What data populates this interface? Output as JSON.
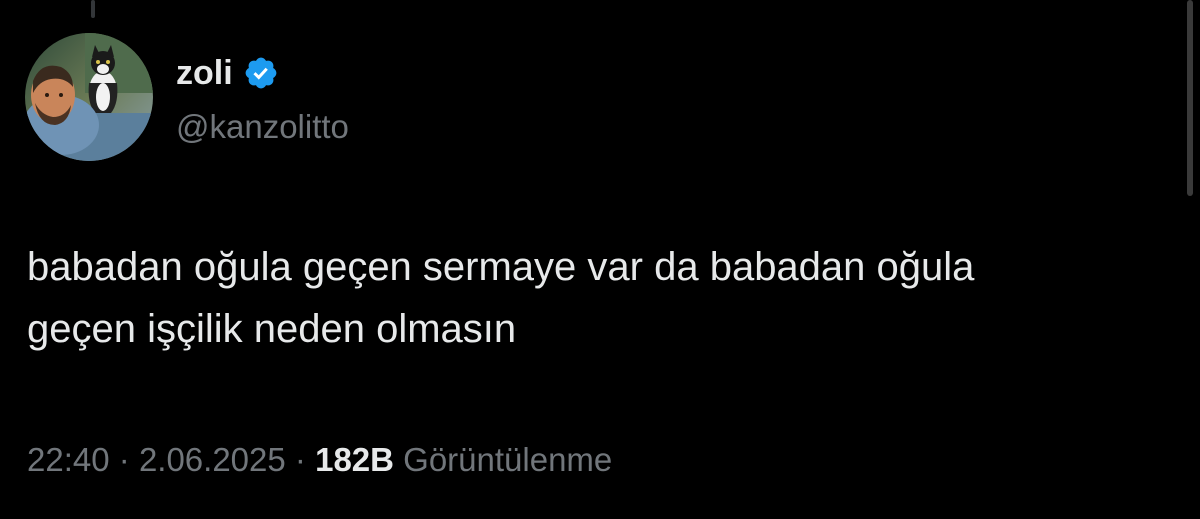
{
  "tweet": {
    "author": {
      "display_name": "zoli",
      "handle": "@kanzolitto",
      "verified": true,
      "avatar_icon": "avatar-portrait-with-cat"
    },
    "text_lines": [
      "babadan oğula geçen sermaye var da babadan oğula",
      "geçen işçilik neden olmasın"
    ],
    "meta": {
      "time": "22:40",
      "separator": "·",
      "date": "2.06.2025",
      "views_count": "182B",
      "views_label": "Görüntülenme"
    }
  },
  "colors": {
    "background": "#000000",
    "primary_text": "#e7e9ea",
    "secondary_text": "#71767b",
    "verified_badge": "#1d9bf0"
  }
}
